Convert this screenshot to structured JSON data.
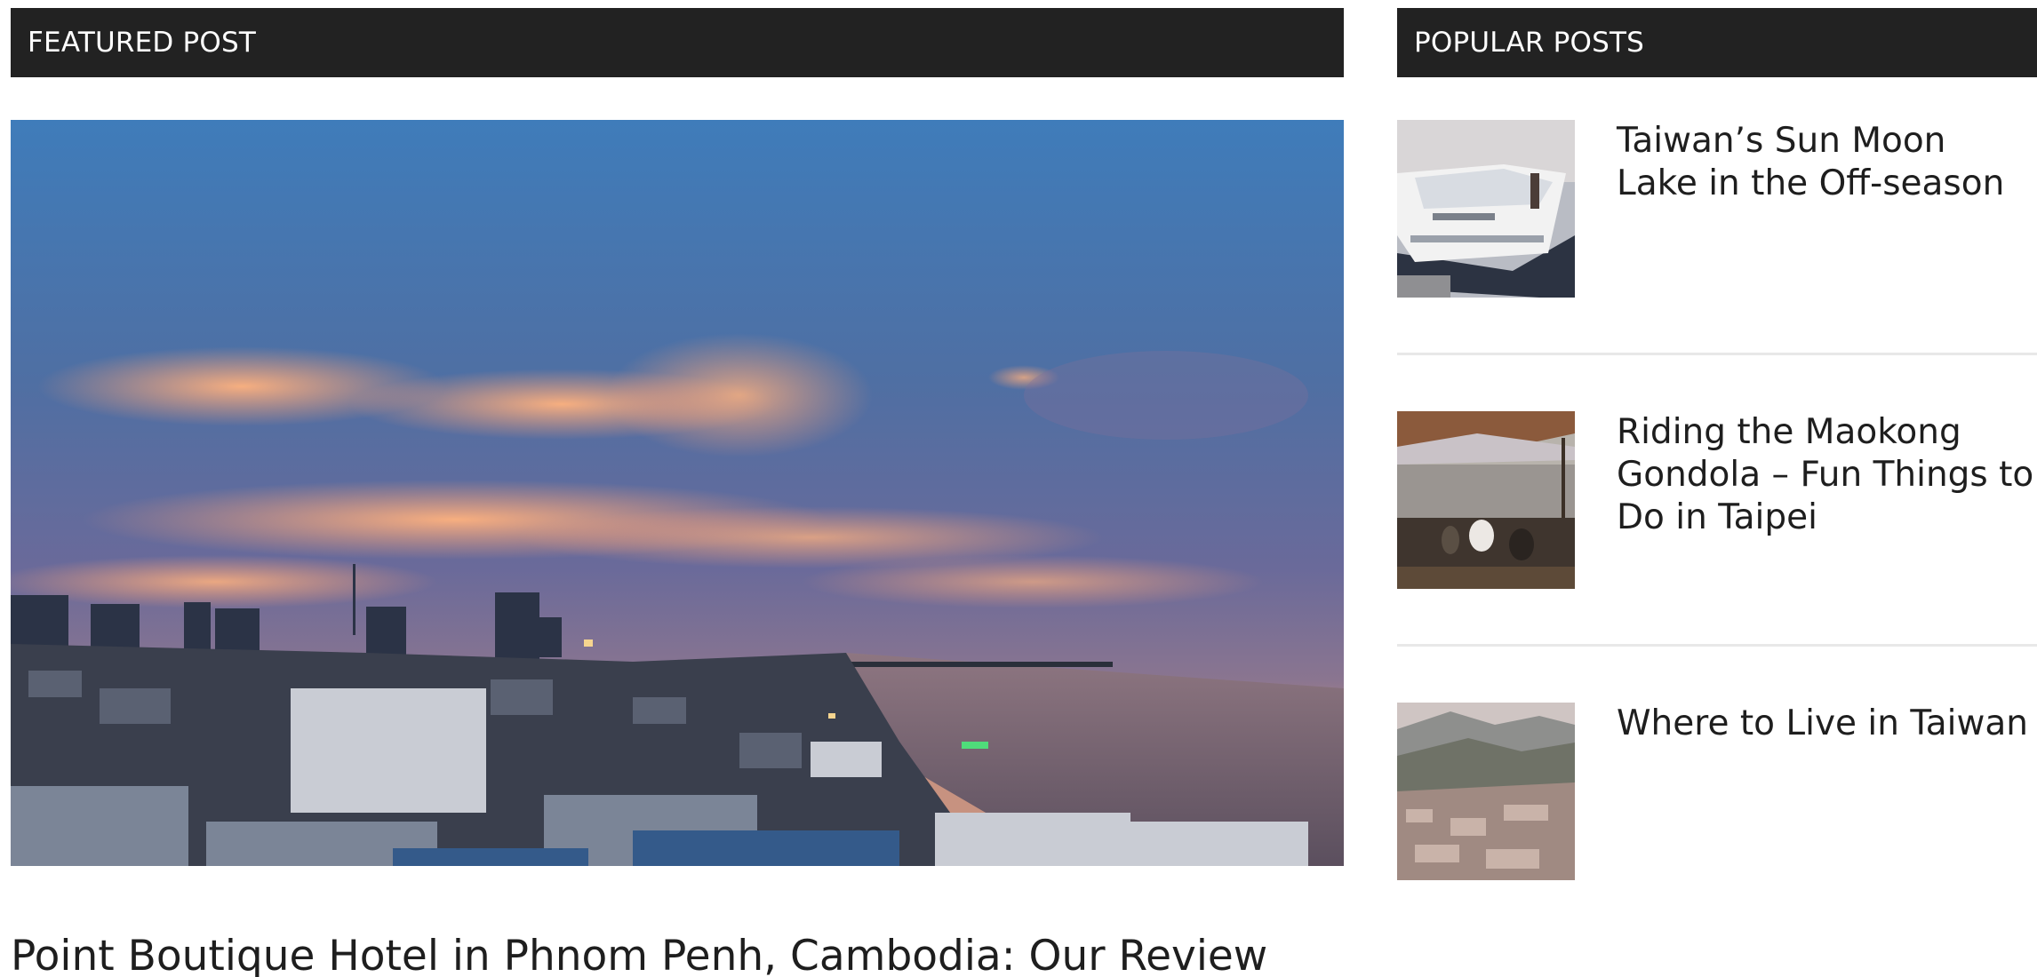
{
  "featured": {
    "heading": "FEATURED POST",
    "title": "Point Boutique Hotel in Phnom Penh, Cambodia: Our Review"
  },
  "popular": {
    "heading": "POPULAR POSTS",
    "items": [
      {
        "title": "Taiwan’s Sun Moon Lake in the Off-season"
      },
      {
        "title": "Riding the Maokong Gondola – Fun Things to Do in Taipei"
      },
      {
        "title": "Where to Live in Taiwan"
      }
    ]
  },
  "colors": {
    "header_bar": "#222222",
    "header_text": "#ffffff",
    "title_text": "#1e1e1e",
    "divider": "#e8e8e8"
  }
}
